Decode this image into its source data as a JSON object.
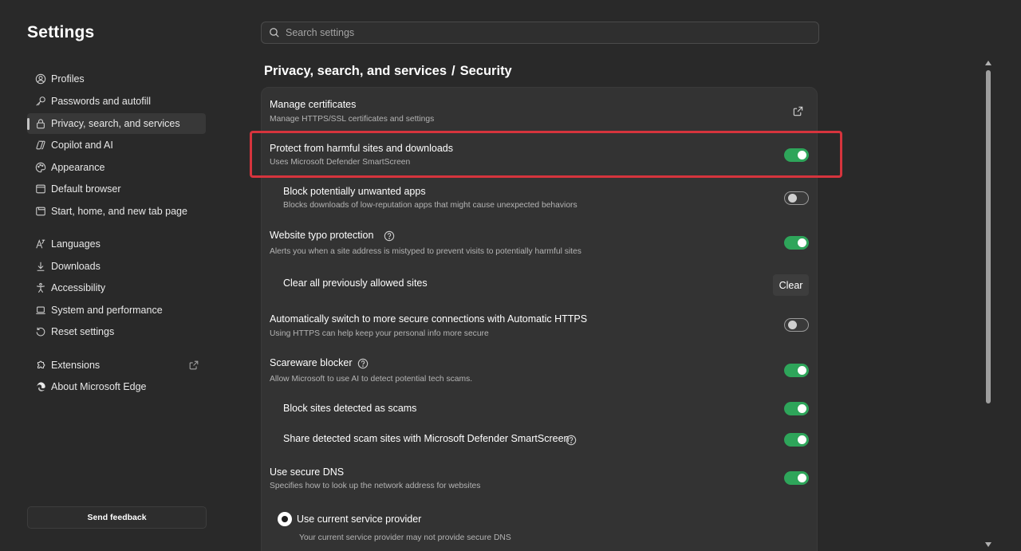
{
  "sidebar": {
    "title": "Settings",
    "items": [
      {
        "label": "Profiles",
        "icon": "profile-icon"
      },
      {
        "label": "Passwords and autofill",
        "icon": "key-icon"
      },
      {
        "label": "Privacy, search, and services",
        "icon": "lock-icon",
        "active": true
      },
      {
        "label": "Copilot and AI",
        "icon": "copilot-icon"
      },
      {
        "label": "Appearance",
        "icon": "appearance-icon"
      },
      {
        "label": "Default browser",
        "icon": "browser-icon"
      },
      {
        "label": "Start, home, and new tab page",
        "icon": "home-icon"
      },
      {
        "label": "Languages",
        "icon": "languages-icon"
      },
      {
        "label": "Downloads",
        "icon": "download-icon"
      },
      {
        "label": "Accessibility",
        "icon": "accessibility-icon"
      },
      {
        "label": "System and performance",
        "icon": "laptop-icon"
      },
      {
        "label": "Reset settings",
        "icon": "reset-icon"
      },
      {
        "label": "Extensions",
        "icon": "puzzle-icon"
      },
      {
        "label": "About Microsoft Edge",
        "icon": "edge-logo-icon"
      }
    ],
    "feedback_label": "Send feedback"
  },
  "search": {
    "placeholder": "Search settings"
  },
  "breadcrumb": {
    "parent": "Privacy, search, and services",
    "separator": "/",
    "current": "Security"
  },
  "settings": {
    "manage_certificates": {
      "title": "Manage certificates",
      "desc": "Manage HTTPS/SSL certificates and settings"
    },
    "protect_harmful": {
      "title": "Protect from harmful sites and downloads",
      "desc": "Uses Microsoft Defender SmartScreen",
      "enabled": true
    },
    "block_pua": {
      "title": "Block potentially unwanted apps",
      "desc": "Blocks downloads of low-reputation apps that might cause unexpected behaviors",
      "enabled": false
    },
    "typo_protection": {
      "title": "Website typo protection",
      "desc": "Alerts you when a site address is mistyped to prevent visits to potentially harmful sites",
      "enabled": true
    },
    "clear_allowed": {
      "title": "Clear all previously allowed sites",
      "button": "Clear"
    },
    "auto_https": {
      "title": "Automatically switch to more secure connections with Automatic HTTPS",
      "desc": "Using HTTPS can help keep your personal info more secure",
      "enabled": false
    },
    "scareware": {
      "title": "Scareware blocker",
      "desc": "Allow Microsoft to use AI to detect potential tech scams.",
      "enabled": true
    },
    "block_scams": {
      "title": "Block sites detected as scams",
      "enabled": true
    },
    "share_scams": {
      "title": "Share detected scam sites with Microsoft Defender SmartScreen",
      "enabled": true
    },
    "secure_dns": {
      "title": "Use secure DNS",
      "desc": "Specifies how to look up the network address for websites",
      "enabled": true
    },
    "dns_current_provider": {
      "title": "Use current service provider",
      "desc": "Your current service provider may not provide secure DNS",
      "selected": true
    }
  },
  "colors": {
    "toggle_on": "#2ea55a",
    "highlight": "#d6343d",
    "background": "#292929",
    "card": "#333333"
  }
}
